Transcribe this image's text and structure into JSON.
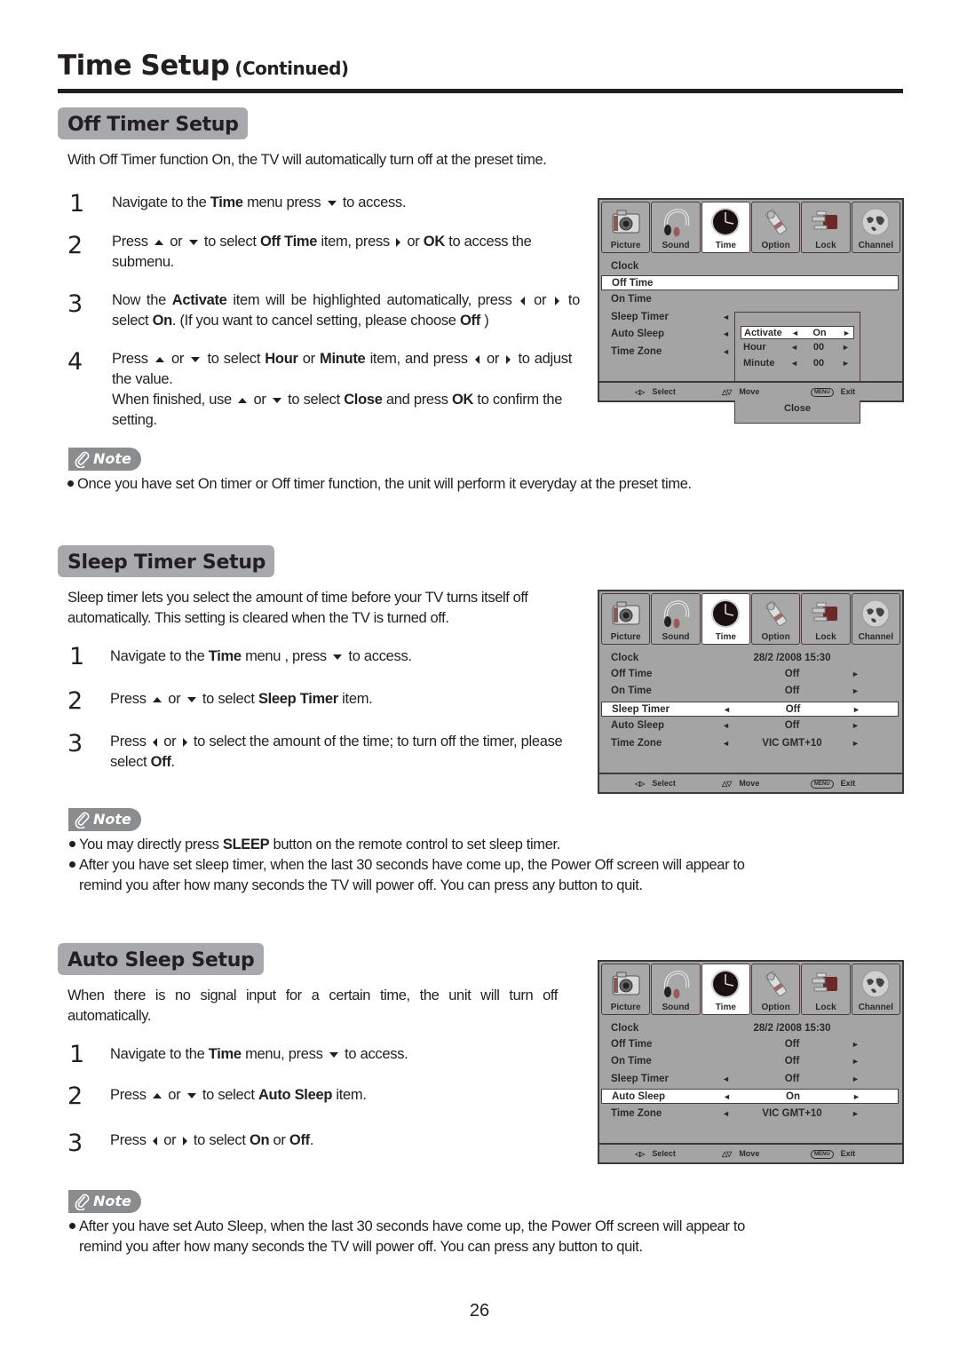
{
  "header": {
    "title": "Time Setup",
    "continued": "(Continued)"
  },
  "off_timer": {
    "heading": "Off Timer Setup",
    "intro": "With Off Timer function On, the TV will automatically turn off at the preset time.",
    "steps": [
      {
        "num": "1",
        "parts": [
          "Navigate to the ",
          "Time",
          " menu  press ",
          "[down]",
          " to access."
        ]
      },
      {
        "num": "2",
        "parts": [
          "Press ",
          "[up]",
          " or ",
          "[down]",
          " to select ",
          "Off Time",
          " item, press ",
          "[right]",
          " or ",
          "OK",
          " to access the submenu."
        ]
      },
      {
        "num": "3",
        "parts": [
          "Now the ",
          "Activate",
          " item will be highlighted automatically, press ",
          "[left]",
          " or ",
          "[right]",
          " to select ",
          "On",
          ". (If you want to cancel setting, please choose ",
          "Off",
          " )"
        ]
      },
      {
        "num": "4",
        "parts": [
          "Press ",
          "[up]",
          " or ",
          "[down]",
          " to select ",
          "Hour",
          " or ",
          "Minute",
          " item, and press ",
          "[left]",
          " or ",
          "[right]",
          " to adjust the value."
        ]
      }
    ],
    "step4_continuation": [
      "When finished, use ",
      "[up]",
      " or ",
      "[down]",
      " to select ",
      "Close",
      " and press ",
      "OK",
      " to confirm the setting."
    ],
    "note_label": "Note",
    "notes": [
      "Once you have set On timer or Off timer function, the unit will perform it everyday at the preset time."
    ]
  },
  "sleep_timer": {
    "heading": "Sleep Timer Setup",
    "intro": "Sleep timer lets you select the amount of time before your TV turns itself off automatically. This setting is cleared when the TV is turned off.",
    "steps": [
      {
        "num": "1",
        "parts": [
          "Navigate to the ",
          "Time",
          " menu , press ",
          "[down]",
          " to access."
        ]
      },
      {
        "num": "2",
        "parts": [
          "Press ",
          "[up]",
          " or ",
          "[down]",
          " to select ",
          "Sleep Timer",
          " item."
        ]
      },
      {
        "num": "3",
        "parts": [
          "Press ",
          "[left]",
          " or ",
          "[right]",
          " to select the amount of the time; to turn off the timer, please select ",
          "Off",
          "."
        ]
      }
    ],
    "note_label": "Note",
    "notes": [
      {
        "parts": [
          "You may directly press ",
          "SLEEP",
          " button on the remote control to set sleep timer."
        ]
      },
      {
        "parts": [
          "After you have set sleep timer, when the last 30 seconds have come up, the Power Off screen will appear to remind you after how many seconds the TV will power off. You can press any button to quit."
        ]
      }
    ]
  },
  "auto_sleep": {
    "heading": "Auto Sleep Setup",
    "intro": "When there is no signal input for a certain time, the unit will turn off automatically.",
    "steps": [
      {
        "num": "1",
        "parts": [
          "Navigate to the ",
          "Time",
          " menu,  press ",
          "[down]",
          " to access."
        ]
      },
      {
        "num": "2",
        "parts": [
          "Press ",
          "[up]",
          " or ",
          "[down]",
          " to select ",
          "Auto Sleep",
          " item."
        ]
      },
      {
        "num": "3",
        "parts": [
          "Press ",
          "[left]",
          " or ",
          "[right]",
          " to select ",
          "On",
          " or ",
          "Off",
          "."
        ]
      }
    ],
    "note_label": "Note",
    "notes": [
      "After you have set Auto Sleep, when the last 30 seconds have come up, the Power Off screen will appear to remind you after how many seconds the TV will power off. You can press any button to quit."
    ]
  },
  "osd": {
    "tabs": [
      {
        "label": "Picture",
        "icon": "camera-icon"
      },
      {
        "label": "Sound",
        "icon": "headphones-icon"
      },
      {
        "label": "Time",
        "icon": "clock-icon"
      },
      {
        "label": "Option",
        "icon": "tools-icon"
      },
      {
        "label": "Lock",
        "icon": "lock-icon"
      },
      {
        "label": "Channel",
        "icon": "globe-icon"
      }
    ],
    "active_tab": "Time",
    "footer": {
      "select_icon": "◁▷",
      "select": "Select",
      "move_icon": "△▽",
      "move": "Move",
      "menu_icon": "MENU",
      "exit": "Exit"
    },
    "left_arrow": "◄",
    "right_arrow": "►",
    "screen1": {
      "rows": [
        {
          "label": "Clock",
          "value": "",
          "left": false,
          "right": false
        },
        {
          "label": "Off Time",
          "value": "",
          "left": false,
          "right": false,
          "selected": true
        },
        {
          "label": "On Time",
          "value": "",
          "left": false,
          "right": false
        },
        {
          "label": "Sleep Timer",
          "value": "",
          "left": true,
          "right": false
        },
        {
          "label": "Auto Sleep",
          "value": "",
          "left": true,
          "right": false
        },
        {
          "label": "Time Zone",
          "value": "",
          "left": true,
          "right": false
        }
      ],
      "popup": {
        "rows": [
          {
            "label": "Activate",
            "value": "On",
            "selected": true
          },
          {
            "label": "Hour",
            "value": "00"
          },
          {
            "label": "Minute",
            "value": "00"
          }
        ],
        "close": "Close"
      }
    },
    "screen2": {
      "rows": [
        {
          "label": "Clock",
          "value": "28/2  /2008 15:30",
          "left": false,
          "right": false
        },
        {
          "label": "Off Time",
          "value": "Off",
          "left": false,
          "right": true
        },
        {
          "label": "On Time",
          "value": "Off",
          "left": false,
          "right": true
        },
        {
          "label": "Sleep Timer",
          "value": "Off",
          "left": true,
          "right": true,
          "selected": true
        },
        {
          "label": "Auto Sleep",
          "value": "Off",
          "left": true,
          "right": true
        },
        {
          "label": "Time Zone",
          "value": "VIC GMT+10",
          "left": true,
          "right": true
        }
      ]
    },
    "screen3": {
      "rows": [
        {
          "label": "Clock",
          "value": "28/2  /2008 15:30",
          "left": false,
          "right": false
        },
        {
          "label": "Off Time",
          "value": "Off",
          "left": false,
          "right": true
        },
        {
          "label": "On Time",
          "value": "Off",
          "left": false,
          "right": true
        },
        {
          "label": "Sleep Timer",
          "value": "Off",
          "left": true,
          "right": true
        },
        {
          "label": "Auto Sleep",
          "value": "On",
          "left": true,
          "right": true,
          "selected": true
        },
        {
          "label": "Time Zone",
          "value": "VIC GMT+10",
          "left": true,
          "right": true
        }
      ]
    }
  },
  "page_number": "26"
}
